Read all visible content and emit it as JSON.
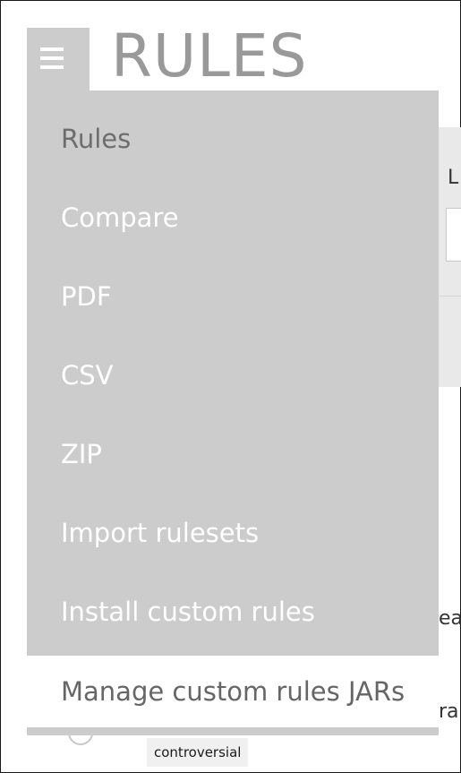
{
  "header": {
    "title": "RULES",
    "menu_icon": "hamburger-menu-icon"
  },
  "menu": {
    "items": [
      {
        "label": "Rules",
        "state": "current"
      },
      {
        "label": "Compare",
        "state": "normal"
      },
      {
        "label": "PDF",
        "state": "normal"
      },
      {
        "label": "CSV",
        "state": "normal"
      },
      {
        "label": "ZIP",
        "state": "normal"
      },
      {
        "label": "Import rulesets",
        "state": "normal"
      },
      {
        "label": "Install custom rules",
        "state": "normal"
      },
      {
        "label": "Manage custom rules JARs",
        "state": "hover"
      }
    ]
  },
  "background": {
    "fragment_top": "L",
    "fragment_mid": "ea",
    "fragment_bottom": "ra",
    "tag_label": "controversial"
  },
  "colors": {
    "menu_bg": "#cccccc",
    "menu_text": "#ffffff",
    "current_item_text": "#6e6e6e",
    "hover_item_bg": "#ffffff",
    "title_text": "#999999"
  }
}
